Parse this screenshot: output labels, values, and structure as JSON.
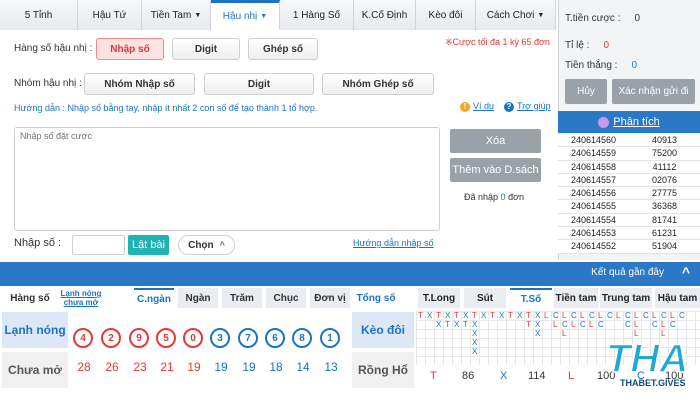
{
  "tabs": [
    {
      "label": "5 Tỉnh",
      "caret": false
    },
    {
      "label": "Hậu Tứ",
      "caret": false
    },
    {
      "label": "Tiền Tam",
      "caret": true
    },
    {
      "label": "Hậu nhị",
      "caret": true,
      "active": true
    },
    {
      "label": "1 Hàng Số",
      "caret": false
    },
    {
      "label": "K.Cố Định",
      "caret": false
    },
    {
      "label": "Kèo đôi",
      "caret": false
    },
    {
      "label": "Cách Chơi",
      "caret": true
    }
  ],
  "caret_symbol": "▼",
  "row1": {
    "label": "Hàng số hậu nhị :",
    "buttons": [
      "Nhập số",
      "Digit",
      "Ghép số"
    ],
    "note": "※Cược tối đa 1 kỳ 65 đơn"
  },
  "row2": {
    "label": "Nhóm hậu nhị :",
    "buttons": [
      "Nhóm Nhập số",
      "Digit",
      "Nhóm Ghép số"
    ]
  },
  "guide": {
    "text": "Hướng dẫn : Nhập số bằng tay, nhập ít nhất 2 con số để tạo thành 1 tổ hợp.",
    "example": "Ví dụ",
    "help": "Trợ giúp",
    "example_icon": "!",
    "help_icon": "?"
  },
  "bet_input": {
    "placeholder": "Nhập số đặt cược"
  },
  "actions": {
    "delete": "Xóa",
    "add": "Thêm vào D.sách",
    "entered_label": "Đã nhập",
    "entered_count": "0",
    "entered_unit": "đơn"
  },
  "bottom_input": {
    "label": "Nhập số :",
    "value": "",
    "flip": "Lật bài",
    "choose": "Chọn",
    "choose_icon": "^",
    "guide_link": "Hướng dẫn nhập số"
  },
  "right_panel": {
    "bet_total_label": "T.tiền cược :",
    "bet_total": "0",
    "rate_label": "Tỉ lệ :",
    "rate": "0",
    "win_label": "Tiền thắng :",
    "win": "0",
    "cancel": "Hủy",
    "confirm": "Xác nhận gửi đi",
    "analysis": "Phân tích",
    "results": [
      [
        "240614560",
        "40913"
      ],
      [
        "240614559",
        "75200"
      ],
      [
        "240614558",
        "41112"
      ],
      [
        "240614557",
        "02076"
      ],
      [
        "240614556",
        "27775"
      ],
      [
        "240614555",
        "36368"
      ],
      [
        "240614554",
        "81741"
      ],
      [
        "240614553",
        "61231"
      ],
      [
        "240614552",
        "51904"
      ]
    ]
  },
  "recent_bar": {
    "label": "Kết quả gần đây",
    "icon": "^"
  },
  "bottom_left": {
    "tabs": [
      "Hàng số",
      "Lạnh nóng chưa mở",
      "C.ngàn",
      "Ngàn",
      "Trăm",
      "Chục",
      "Đơn vị"
    ],
    "active_tab": 2,
    "row1_label": "Lạnh nóng",
    "row2_label": "Chưa mở",
    "digits": [
      "4",
      "2",
      "9",
      "5",
      "0",
      "3",
      "7",
      "6",
      "8",
      "1"
    ],
    "digit_colors": [
      "#e53935",
      "#e53935",
      "#e53935",
      "#e53935",
      "#e53935",
      "#1a73c8",
      "#1a73c8",
      "#1a73c8",
      "#1a73c8",
      "#1a73c8"
    ],
    "counts": [
      "28",
      "26",
      "23",
      "21",
      "19",
      "19",
      "19",
      "18",
      "14",
      "13"
    ],
    "count_colors": [
      "#e53935",
      "#e53935",
      "#e53935",
      "#e53935",
      "#e53935",
      "#1a73c8",
      "#1a73c8",
      "#1a73c8",
      "#1a73c8",
      "#1a73c8"
    ]
  },
  "bottom_right": {
    "tabs": [
      "Tổng số",
      "T.Long",
      "Sút",
      "T.Số",
      "Tiền tam",
      "Trung tam",
      "Hậu tam"
    ],
    "active_tab": 3,
    "row1_label": "Kèo đôi",
    "row2_label": "Rồng Hổ",
    "summary": [
      {
        "k": "T",
        "v": "86"
      },
      {
        "k": "X",
        "v": "114"
      },
      {
        "k": "L",
        "v": "100"
      },
      {
        "k": "C",
        "v": "100"
      }
    ],
    "grid_marks": [
      [
        "T",
        "X",
        "T",
        "X",
        "T",
        "X",
        "T",
        "X",
        "T",
        "X",
        "T",
        "X",
        "T",
        "X",
        "L",
        "C",
        "L",
        "C",
        "L",
        "C",
        "L",
        "C",
        "L",
        "C",
        "L",
        "C",
        "L",
        "C",
        "L",
        "C"
      ],
      [
        "",
        "",
        "X",
        "T",
        "X",
        "T",
        "X",
        "",
        "",
        "",
        "",
        "",
        "T",
        "X",
        "",
        "L",
        "C",
        "L",
        "C",
        "L",
        "C",
        "",
        "",
        "C",
        "L",
        "",
        "C",
        "L",
        "C",
        ""
      ],
      [
        "",
        "",
        "",
        "",
        "",
        "",
        "X",
        "",
        "",
        "",
        "",
        "",
        "",
        "X",
        "",
        "",
        "L",
        "",
        "",
        "",
        "",
        "",
        "",
        "",
        "L",
        "",
        "",
        "L",
        "",
        ""
      ],
      [
        "",
        "",
        "",
        "",
        "",
        "",
        "X",
        "",
        "",
        "",
        "",
        "",
        "",
        "",
        "",
        "",
        "",
        "",
        "",
        "",
        "",
        "",
        "",
        "",
        "",
        "",
        "",
        "",
        "",
        ""
      ],
      [
        "",
        "",
        "",
        "",
        "",
        "",
        "X",
        "",
        "",
        "",
        "",
        "",
        "",
        "",
        "",
        "",
        "",
        "",
        "",
        "",
        "",
        "",
        "",
        "",
        "",
        "",
        "",
        "",
        "",
        ""
      ]
    ]
  },
  "logo": {
    "text": "THA",
    "sub": "THABET.GIVES"
  },
  "colors": {
    "accent": "#1a73c8",
    "blue_bar": "#2b78c6",
    "red": "#e53935",
    "logo": "#1fa8d6"
  }
}
